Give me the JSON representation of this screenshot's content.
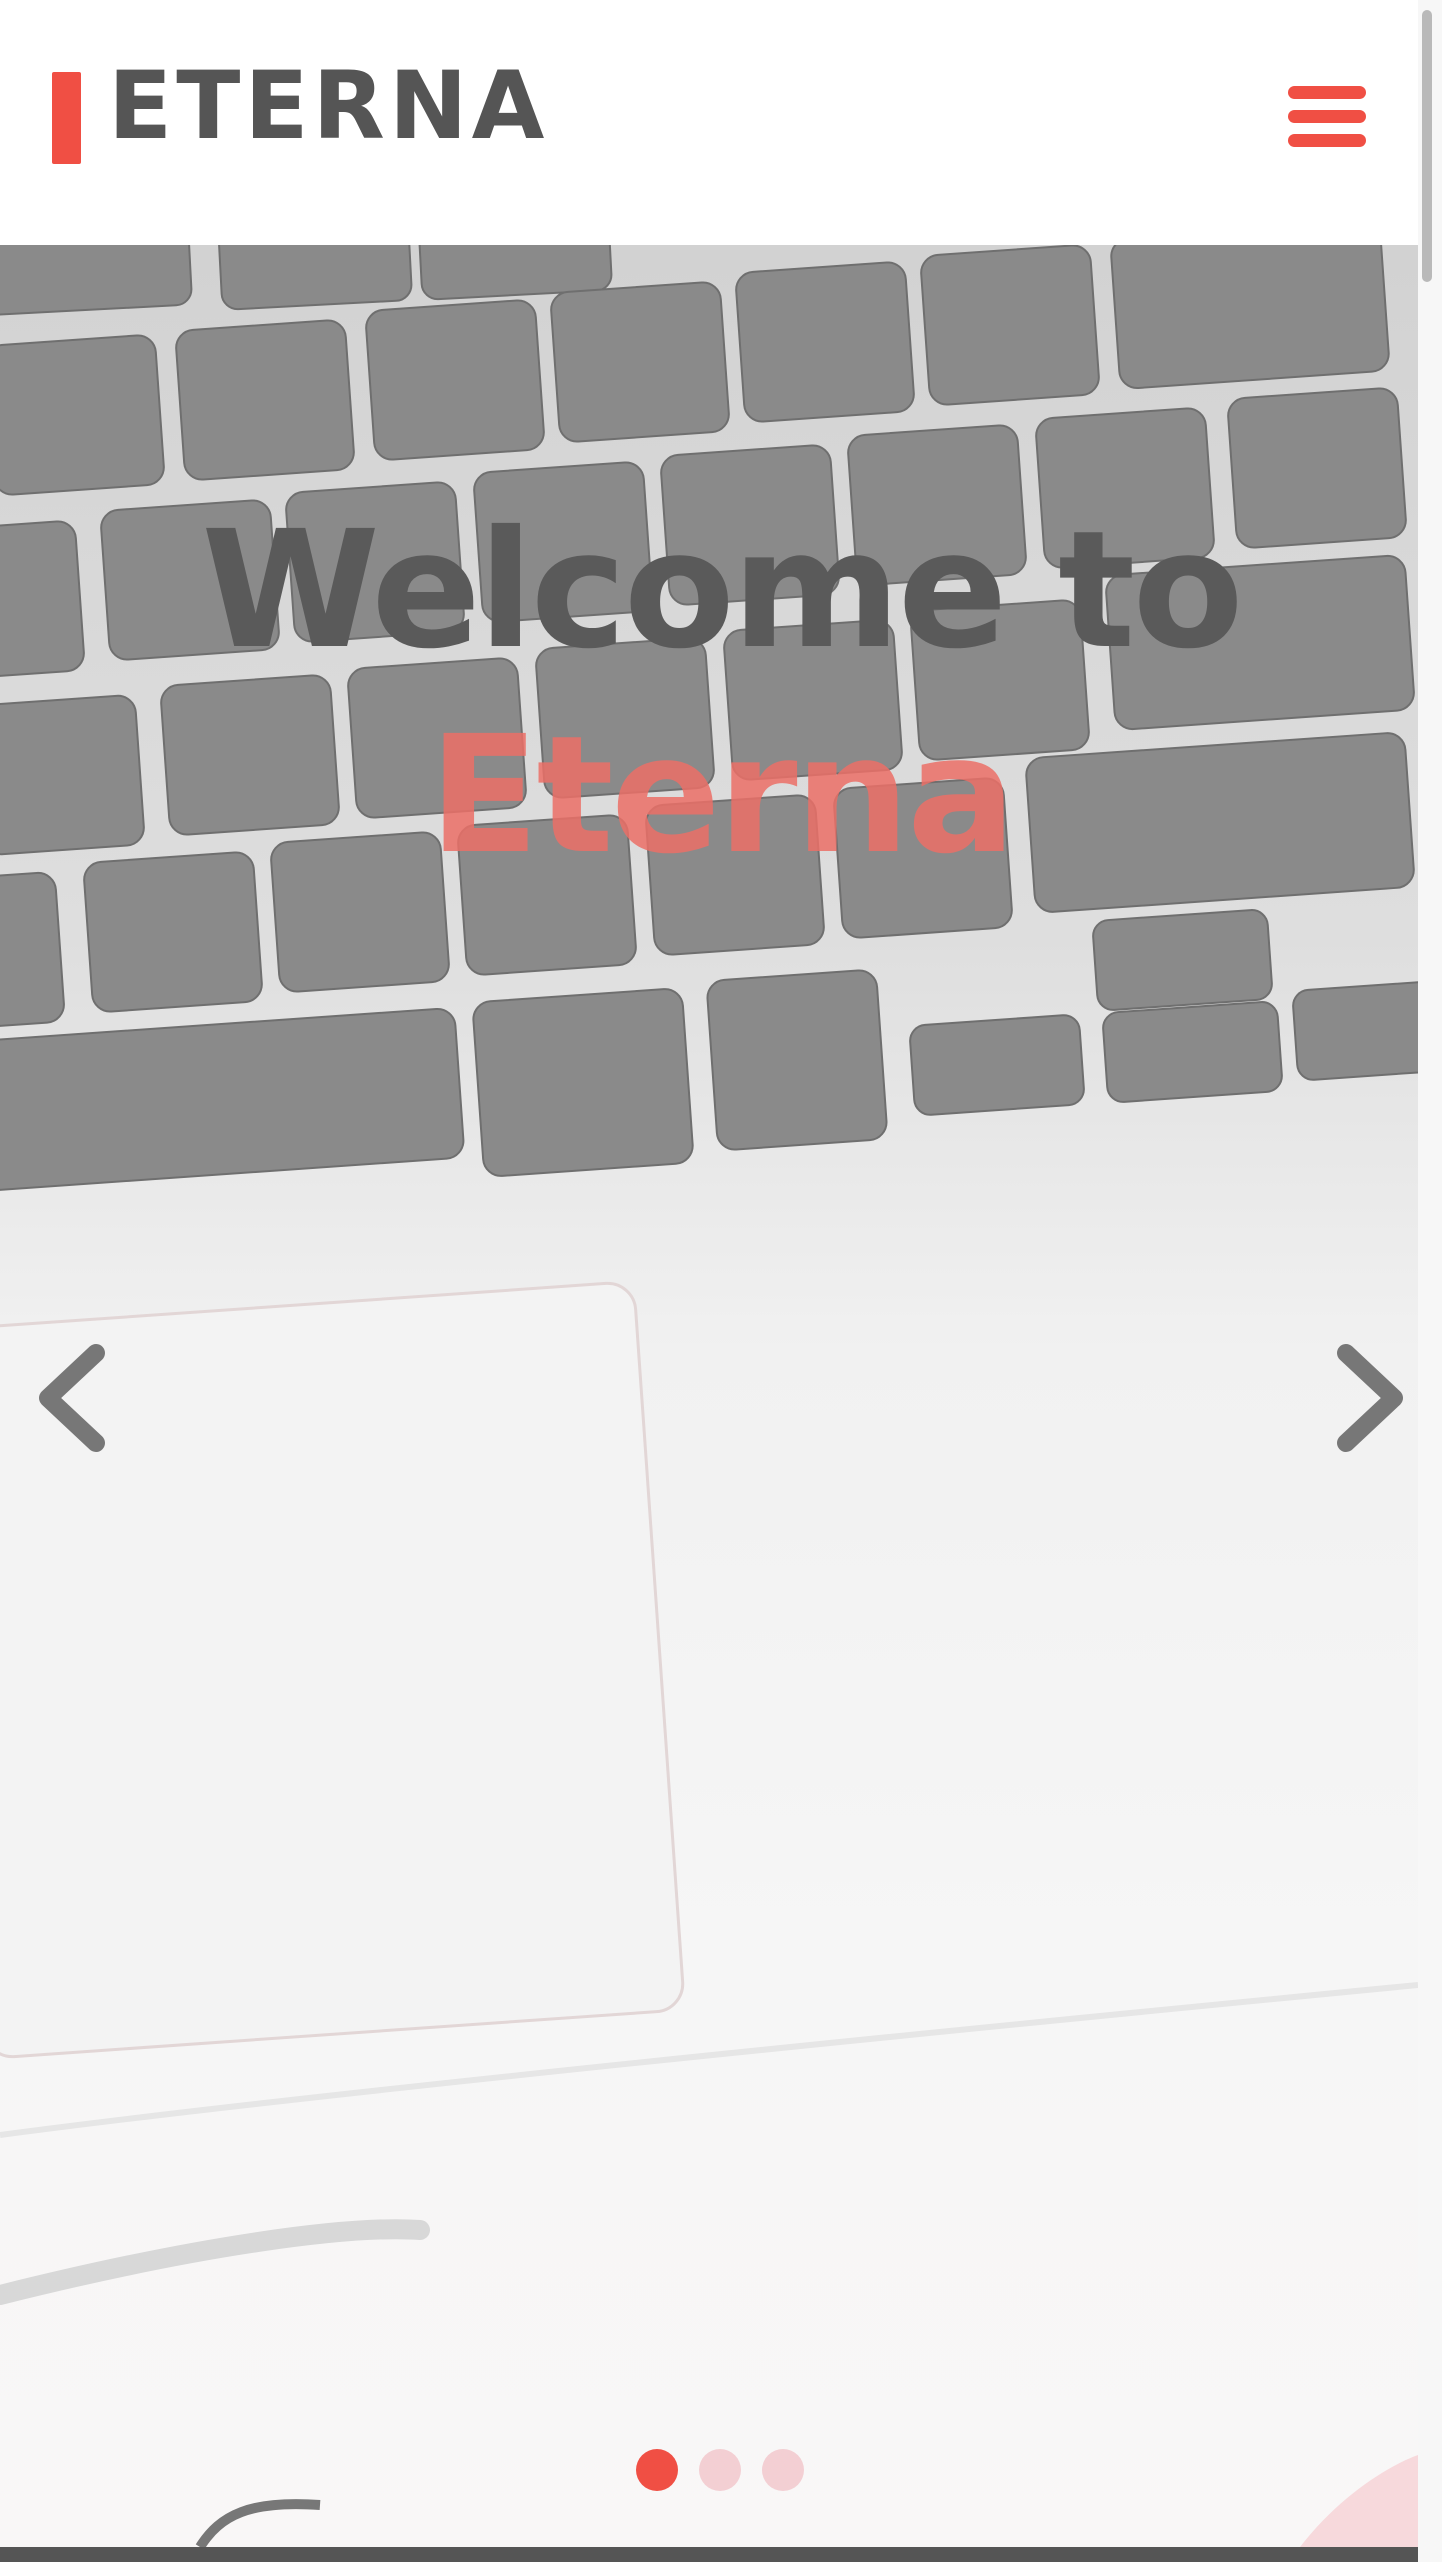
{
  "header": {
    "brand": "ETERNA",
    "menu_icon": "hamburger-menu-icon"
  },
  "hero": {
    "title_line1": "Welcome to",
    "title_line2": "Eterna",
    "prev_icon": "chevron-left-icon",
    "next_icon": "chevron-right-icon",
    "slides_total": 3,
    "active_slide": 1
  },
  "colors": {
    "accent": "#f04f44",
    "text_dark": "#555555",
    "dot_inactive": "#f3cfd3"
  }
}
